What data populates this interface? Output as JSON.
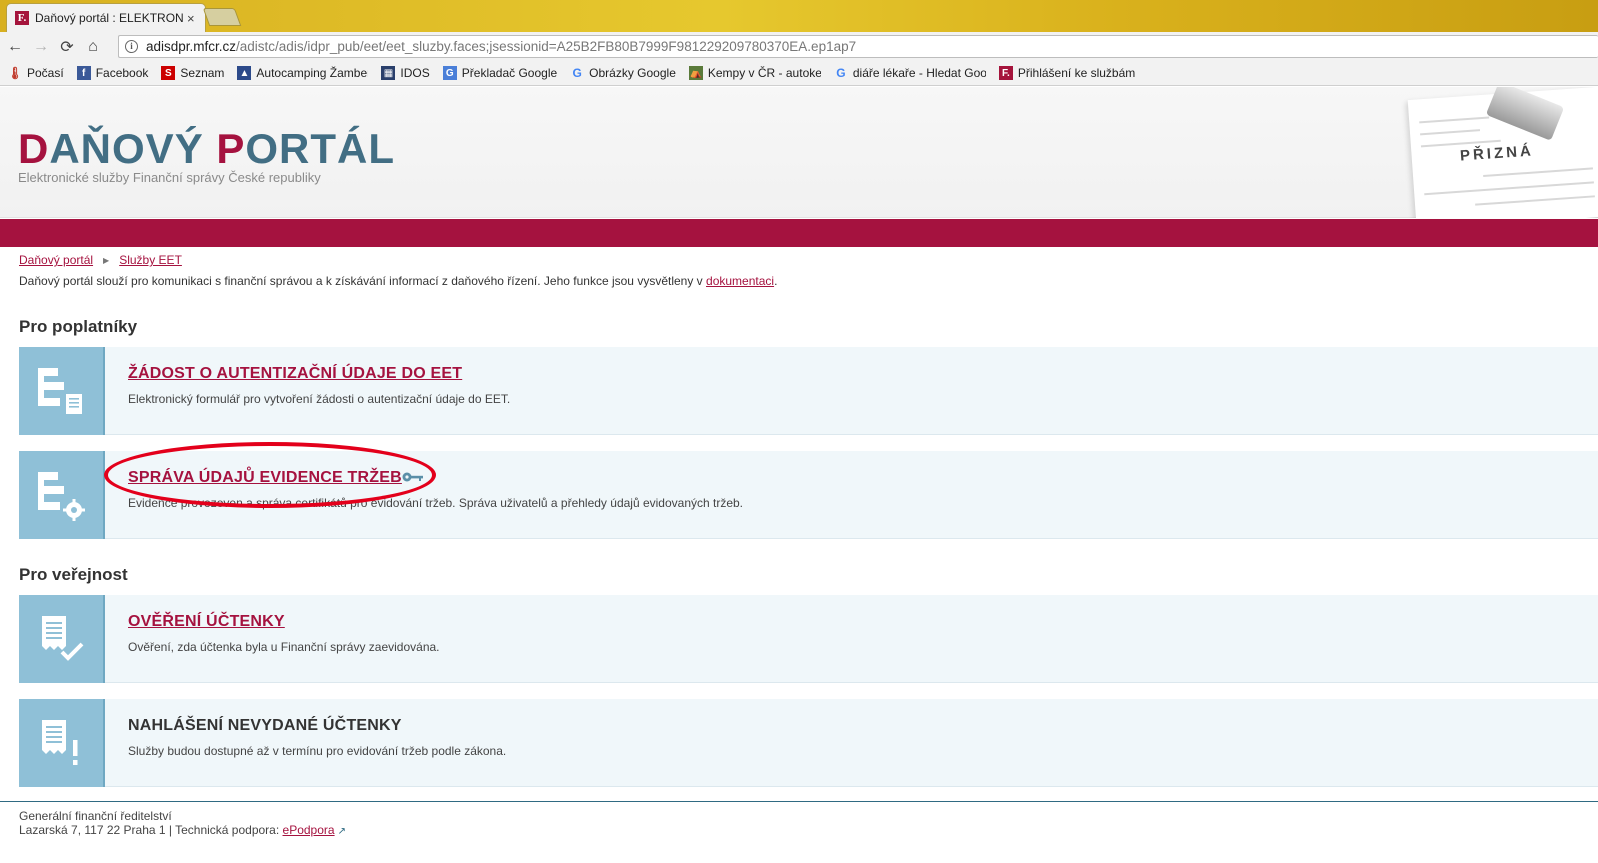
{
  "browser": {
    "tab_title": "Daňový portál : ELEKTRONICKÉ",
    "tab_close": "×",
    "favicon_letter": "F.",
    "url_host": "adisdpr.mfcr.cz",
    "url_path": "/adistc/adis/idpr_pub/eet/eet_sluzby.faces;jsessionid=A25B2FB80B7999F981229209780370EA.ep1ap7",
    "nav": {
      "back": "←",
      "forward": "→",
      "reload": "⟳",
      "home": "⌂",
      "info": "i"
    },
    "bookmarks": [
      {
        "label": "Počasí",
        "icon": "weather-icon",
        "glyph": "🌡",
        "color": "#c0392b"
      },
      {
        "label": "Facebook",
        "icon": "facebook-icon",
        "glyph": "f",
        "color": "#3b5998"
      },
      {
        "label": "Seznam",
        "icon": "seznam-icon",
        "glyph": "S",
        "color": "#cc0000"
      },
      {
        "label": "Autocamping Žamberk",
        "icon": "autocamping-icon",
        "glyph": "▲",
        "color": "#2c4a8a"
      },
      {
        "label": "IDOS",
        "icon": "idos-icon",
        "glyph": "▦",
        "color": "#2a3f6b"
      },
      {
        "label": "Překladač Google",
        "icon": "translate-icon",
        "glyph": "G",
        "color": "#4a7fd8"
      },
      {
        "label": "Obrázky Google",
        "icon": "google-icon",
        "glyph": "G",
        "color": "#4285f4"
      },
      {
        "label": "Kempy v ČR - autokempy",
        "icon": "kempy-icon",
        "glyph": "⛺",
        "color": "#5a7a3a"
      },
      {
        "label": "diáře lékaře - Hledat Googlem",
        "icon": "google-icon",
        "glyph": "G",
        "color": "#4285f4"
      },
      {
        "label": "Přihlášení ke službám",
        "icon": "fs-icon",
        "glyph": "F.",
        "color": "#a5143c"
      }
    ]
  },
  "header": {
    "title_parts": [
      "D",
      "AŇOVÝ ",
      "P",
      "ORTÁL"
    ],
    "subtitle": "Elektronické služby Finanční správy České republiky",
    "art_title": "PŘIZNÁ"
  },
  "breadcrumb": {
    "items": [
      "Daňový portál",
      "Služby EET"
    ],
    "separator": "▶"
  },
  "intro": {
    "text_before": "Daňový portál slouží pro komunikaci s finanční správou a k získávání informací z daňového řízení. Jeho funkce jsou vysvětleny v ",
    "link": "dokumentaci",
    "text_after": "."
  },
  "sections": [
    {
      "heading": "Pro poplatníky",
      "cards": [
        {
          "title": "ŽÁDOST O AUTENTIZAČNÍ ÚDAJE DO EET",
          "desc": "Elektronický formulář pro vytvoření žádosti o autentizační údaje do EET.",
          "icon": "form-document-icon"
        },
        {
          "title": "SPRÁVA ÚDAJŮ EVIDENCE TRŽEB",
          "desc": "Evidence provozoven a správa certifikátů pro evidování tržeb. Správa uživatelů a přehledy údajů evidovaných tržeb.",
          "icon": "form-settings-icon",
          "key_icon": "key-icon"
        }
      ]
    },
    {
      "heading": "Pro veřejnost",
      "cards": [
        {
          "title": "OVĚŘENÍ ÚČTENKY",
          "desc": "Ověření, zda účtenka byla u Finanční správy zaevidována.",
          "icon": "receipt-check-icon"
        },
        {
          "title": "NAHLÁŠENÍ NEVYDANÉ ÚČTENKY",
          "desc": "Služby budou dostupné až v termínu pro evidování tržeb podle zákona.",
          "icon": "receipt-alert-icon"
        }
      ]
    }
  ],
  "footer": {
    "line1": "Generální finanční ředitelství",
    "line2_text": "Lazarská 7, 117 22 Praha 1 | Technická podpora: ",
    "support_link": "ePodpora",
    "ext_icon": "↗"
  },
  "colors": {
    "brand": "#a5123f",
    "accent_blue": "#426e84",
    "card_icon_bg": "#8fc0d7",
    "annotation": "#e3001b"
  }
}
